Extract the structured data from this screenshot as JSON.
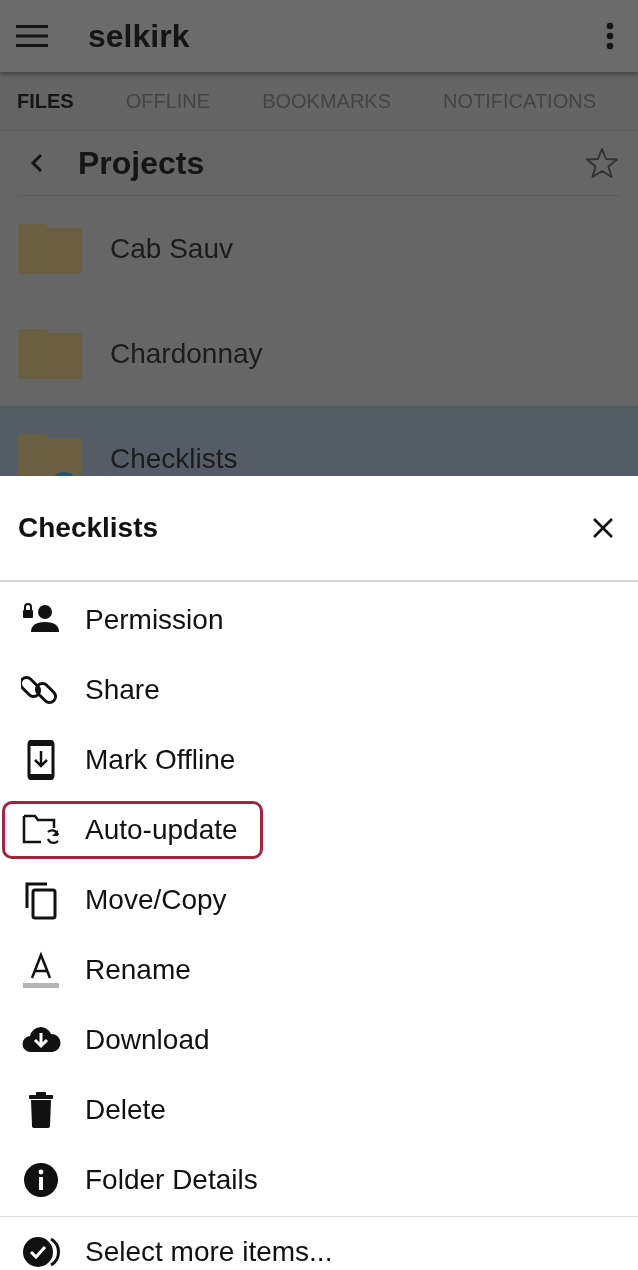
{
  "app_bar": {
    "title": "selkirk"
  },
  "tabs": [
    {
      "label": "FILES",
      "selected": true
    },
    {
      "label": "OFFLINE",
      "selected": false
    },
    {
      "label": "BOOKMARKS",
      "selected": false
    },
    {
      "label": "NOTIFICATIONS",
      "selected": false
    }
  ],
  "breadcrumb": {
    "title": "Projects",
    "bookmarked": false
  },
  "folders": [
    {
      "name": "Cab Sauv",
      "selected": false,
      "badge": false
    },
    {
      "name": "Chardonnay",
      "selected": false,
      "badge": false
    },
    {
      "name": "Checklists",
      "selected": true,
      "badge": true
    }
  ],
  "sheet": {
    "title": "Checklists",
    "actions": [
      {
        "label": "Permission",
        "highlighted": false
      },
      {
        "label": "Share",
        "highlighted": false
      },
      {
        "label": "Mark Offline",
        "highlighted": false
      },
      {
        "label": "Auto-update",
        "highlighted": true
      },
      {
        "label": "Move/Copy",
        "highlighted": false
      },
      {
        "label": "Rename",
        "highlighted": false
      },
      {
        "label": "Download",
        "highlighted": false
      },
      {
        "label": "Delete",
        "highlighted": false
      },
      {
        "label": "Folder Details",
        "highlighted": false
      }
    ],
    "footer_action": {
      "label": "Select more items..."
    }
  }
}
